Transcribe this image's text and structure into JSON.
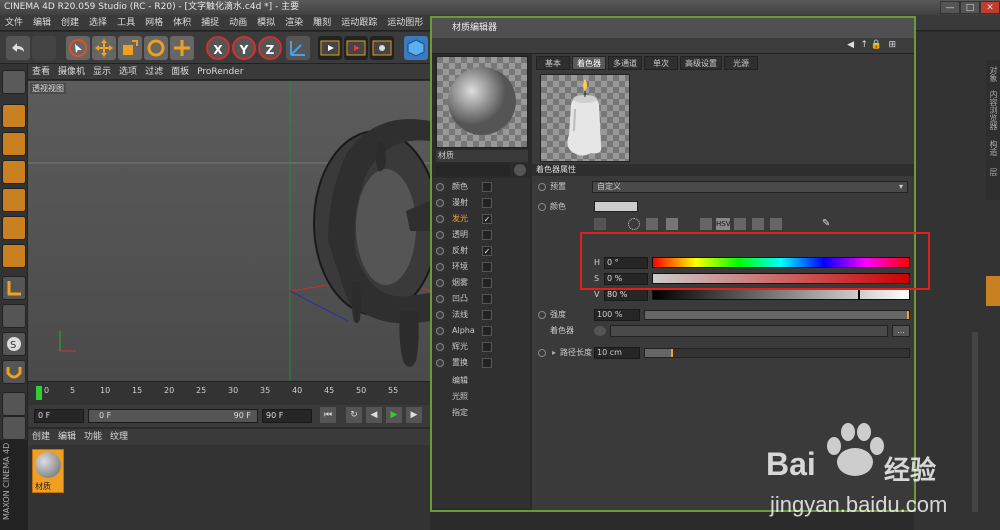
{
  "app": {
    "title": "CINEMA 4D R20.059 Studio (RC - R20) - [文字触化滴水.c4d *] - 主要",
    "window_buttons": [
      "—",
      "□",
      "✕"
    ]
  },
  "menubar": [
    "文件",
    "编辑",
    "创建",
    "选择",
    "工具",
    "网格",
    "体积",
    "捕捉",
    "动画",
    "模拟",
    "渲染",
    "雕刻",
    "运动跟踪",
    "运动图形",
    "角色"
  ],
  "toolbar": {
    "x": "X",
    "y": "Y",
    "z": "Z"
  },
  "viewport": {
    "menu": [
      "查看",
      "摄像机",
      "显示",
      "选项",
      "过滤",
      "面板",
      "ProRender"
    ],
    "label": "透视视图"
  },
  "timeline": {
    "ticks": [
      "0",
      "5",
      "10",
      "15",
      "20",
      "25",
      "30",
      "35",
      "40",
      "45",
      "50",
      "55"
    ],
    "start_field": "0 F",
    "slider_start": "0 F",
    "slider_end": "90 F",
    "end_field": "90 F"
  },
  "material_manager": {
    "menu": [
      "创建",
      "编辑",
      "功能",
      "纹理"
    ],
    "material_name": "材质"
  },
  "maxon_logo": "MAXON CINEMA 4D",
  "right_panel": {
    "vertical_tabs": [
      "对象",
      "内容浏览器",
      "构造",
      "层"
    ]
  },
  "dialog": {
    "title": "材质编辑器",
    "material_name": "材质",
    "channels": [
      {
        "label": "颜色",
        "checked": false,
        "hot": false
      },
      {
        "label": "漫射",
        "checked": false,
        "hot": false
      },
      {
        "label": "发光",
        "checked": true,
        "hot": true
      },
      {
        "label": "透明",
        "checked": false,
        "hot": false
      },
      {
        "label": "反射",
        "checked": true,
        "hot": false
      },
      {
        "label": "环境",
        "checked": false,
        "hot": false
      },
      {
        "label": "烟雾",
        "checked": false,
        "hot": false
      },
      {
        "label": "凹凸",
        "checked": false,
        "hot": false
      },
      {
        "label": "法线",
        "checked": false,
        "hot": false
      },
      {
        "label": "Alpha",
        "checked": false,
        "hot": false
      },
      {
        "label": "辉光",
        "checked": false,
        "hot": false
      },
      {
        "label": "置换",
        "checked": false,
        "hot": false
      }
    ],
    "extra_items": [
      "编辑",
      "光照",
      "指定"
    ],
    "tabs": [
      {
        "label": "基本",
        "active": false
      },
      {
        "label": "着色器",
        "active": true
      },
      {
        "label": "多通道",
        "active": false
      },
      {
        "label": "单次",
        "active": false
      },
      {
        "label": "高级设置",
        "active": false
      },
      {
        "label": "光源",
        "active": false
      }
    ],
    "section_header": "着色器属性",
    "preset_label": "预置",
    "preset_value": "自定义",
    "color_label": "颜色",
    "hsv": {
      "h_label": "H",
      "h_value": "0 °",
      "s_label": "S",
      "s_value": "0 %",
      "v_label": "V",
      "v_value": "80 %",
      "v_level": 0.8
    },
    "strength_label": "强度",
    "strength_value": "100 %",
    "strength_level": 1.0,
    "shader_label": "着色器",
    "shader_btn": "...",
    "radius_label": "路径长度",
    "radius_value": "10 cm"
  },
  "watermark": {
    "brand": "Bai",
    "brand2": "经验",
    "url": "jingyan.baidu.com"
  },
  "colors": {
    "dialog_border": "#6a9a3a",
    "highlight": "#e02020",
    "accent": "#f0a030"
  }
}
